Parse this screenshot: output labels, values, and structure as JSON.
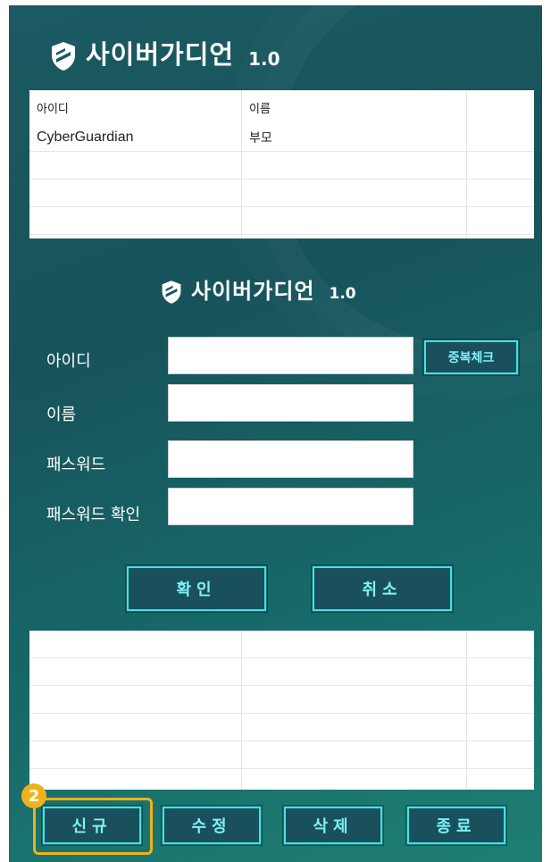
{
  "app": {
    "title": "사이버가디언",
    "version": "1.0"
  },
  "top_table": {
    "headers": [
      "아이디",
      "이름"
    ],
    "rows": [
      [
        "CyberGuardian",
        "부모"
      ]
    ]
  },
  "form": {
    "title": "사이버가디언",
    "version": "1.0",
    "id_label": "아이디",
    "name_label": "이름",
    "password_label": "패스워드",
    "password_confirm_label": "패스워드 확인",
    "id_value": "",
    "name_value": "",
    "password_value": "",
    "password_confirm_value": "",
    "dup_check_button": "중복체크",
    "confirm_button": "확인",
    "cancel_button": "취소"
  },
  "bottom_buttons": {
    "new": "신규",
    "edit": "수정",
    "delete": "삭제",
    "exit": "종료"
  },
  "annotation": {
    "badge": "2"
  },
  "colors": {
    "accent": "#3fe2e8",
    "button_bg": "#1a4f5c",
    "highlight": "#f0b21a"
  }
}
